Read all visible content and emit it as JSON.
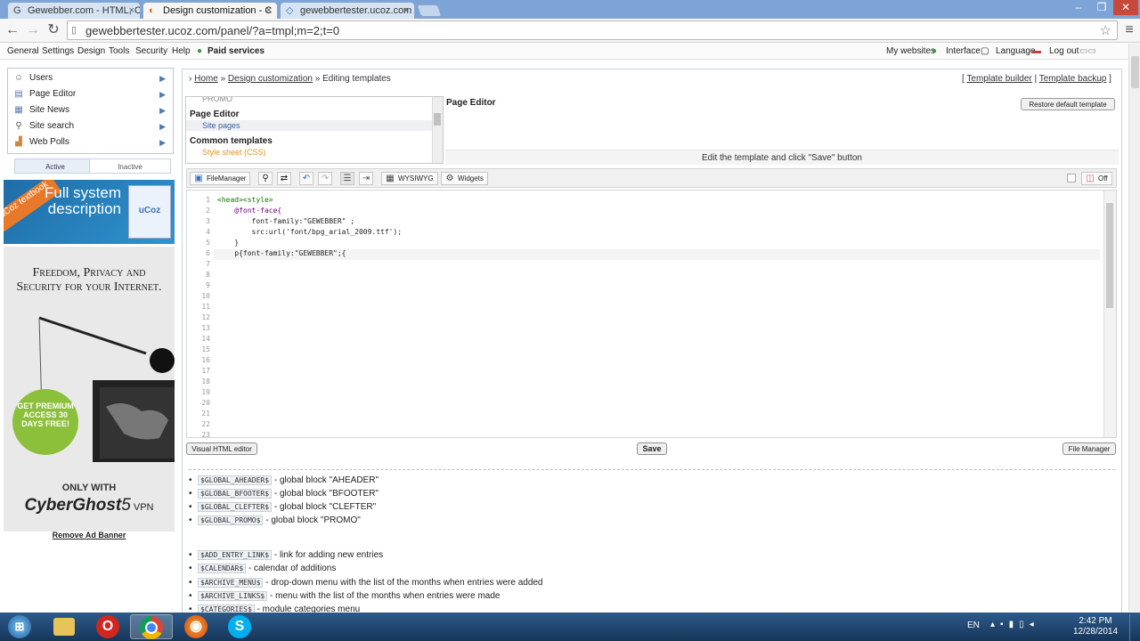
{
  "browser": {
    "tabs": [
      {
        "title": "Gewebber.com - HTML, C",
        "favicon": "G"
      },
      {
        "title": "Design customization - C",
        "favicon": "◐"
      },
      {
        "title": "gewebbertester.ucoz.com",
        "favicon": "◇"
      }
    ],
    "url": "gewebbertester.ucoz.com/panel/?a=tmpl;m=2;t=0"
  },
  "topmenu": {
    "left": [
      "General",
      "Settings",
      "Design",
      "Tools",
      "Security",
      "Help"
    ],
    "paid": "Paid services",
    "right": [
      "My websites",
      "Interface",
      "Language",
      "Log out"
    ]
  },
  "sidebar": {
    "items": [
      {
        "label": "Users",
        "icon": "user-icon"
      },
      {
        "label": "Page Editor",
        "icon": "page-icon"
      },
      {
        "label": "Site News",
        "icon": "news-icon"
      },
      {
        "label": "Site search",
        "icon": "search-icon"
      },
      {
        "label": "Web Polls",
        "icon": "chart-icon"
      }
    ],
    "tab_active": "Active",
    "tab_inactive": "Inactive",
    "ad1_badge": "uCoz textbook",
    "ad1_text": "Full system description",
    "ad1_logo": "uCoz",
    "ad2_head": "Freedom, Privacy and Security for your Internet.",
    "ad2_offer": "GET PREMIUM ACCESS 30 DAYS FREE!",
    "ad2_only": "ONLY WITH",
    "ad2_brand": "CyberGhost",
    "ad2_ver": "5",
    "ad2_vpn": "VPN",
    "remove_ad": "Remove Ad Banner"
  },
  "breadcrumb": {
    "home": "Home",
    "design": "Design customization",
    "current": "Editing templates",
    "template_builder": "Template builder",
    "template_backup": "Template backup"
  },
  "templates": {
    "promo": "PROMO",
    "page_editor_head": "Page Editor",
    "site_pages": "Site pages",
    "common_head": "Common templates",
    "style_sheet": "Style sheet (CSS)"
  },
  "editor": {
    "title": "Page Editor",
    "restore": "Restore default template",
    "hint": "Edit the template and click \"Save\" button",
    "toolbar": {
      "file_manager": "FileManager",
      "wysiwyg": "WYSIWYG",
      "widgets": "Widgets",
      "off": "Off"
    },
    "code_lines": [
      {
        "n": "1",
        "text": "<head><style>"
      },
      {
        "n": "2",
        "text": "    @font-face{"
      },
      {
        "n": "3",
        "text": "        font-family:\"GEWEBBER\" ;"
      },
      {
        "n": "4",
        "text": "        src:url('font/bpg_arial_2009.ttf');"
      },
      {
        "n": "5",
        "text": "    }"
      },
      {
        "n": "6",
        "text": "    p{font-family:\"GEWEBBER\";{"
      },
      {
        "n": "7",
        "text": ""
      },
      {
        "n": "8",
        "text": ""
      },
      {
        "n": "9",
        "text": ""
      },
      {
        "n": "10",
        "text": ""
      },
      {
        "n": "11",
        "text": ""
      },
      {
        "n": "12",
        "text": ""
      },
      {
        "n": "13",
        "text": ""
      },
      {
        "n": "14",
        "text": ""
      },
      {
        "n": "15",
        "text": ""
      },
      {
        "n": "16",
        "text": ""
      },
      {
        "n": "17",
        "text": ""
      },
      {
        "n": "18",
        "text": ""
      },
      {
        "n": "19",
        "text": ""
      },
      {
        "n": "20",
        "text": ""
      },
      {
        "n": "21",
        "text": ""
      },
      {
        "n": "22",
        "text": ""
      },
      {
        "n": "23",
        "text": ""
      }
    ],
    "visual_html": "Visual HTML editor",
    "save": "Save",
    "file_manager_btn": "File Manager"
  },
  "variables": [
    {
      "code": "$GLOBAL_AHEADER$",
      "desc": "- global block \"AHEADER\""
    },
    {
      "code": "$GLOBAL_BFOOTER$",
      "desc": "- global block \"BFOOTER\""
    },
    {
      "code": "$GLOBAL_CLEFTER$",
      "desc": "- global block \"CLEFTER\""
    },
    {
      "code": "$GLOBAL_PROMO$",
      "desc": "- global block \"PROMO\""
    },
    {
      "code": "$ADD_ENTRY_LINK$",
      "desc": "- link for adding new entries"
    },
    {
      "code": "$CALENDAR$",
      "desc": "- calendar of additions"
    },
    {
      "code": "$ARCHIVE_MENU$",
      "desc": "- drop-down menu with the list of the months when entries were added"
    },
    {
      "code": "$ARCHIVE_LINKS$",
      "desc": "- menu with the list of the months when entries were made"
    },
    {
      "code": "$CATEGORIES$",
      "desc": "- module categories menu"
    }
  ],
  "taskbar": {
    "lang": "EN",
    "time": "2:42 PM",
    "date": "12/28/2014"
  }
}
